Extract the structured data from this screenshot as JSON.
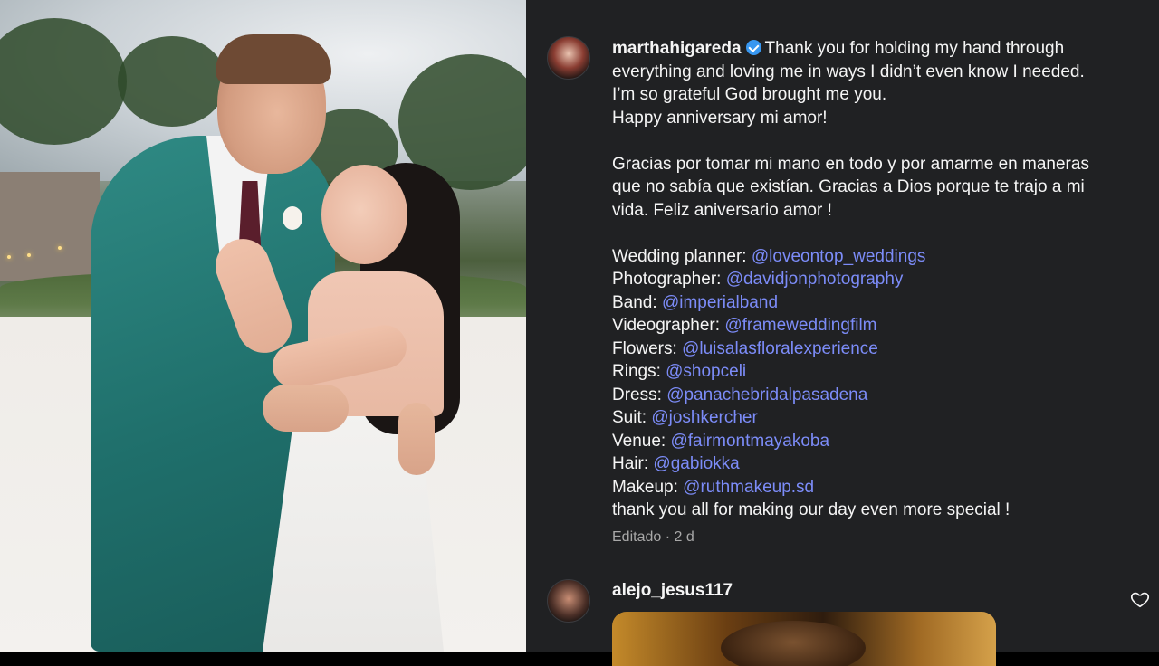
{
  "post": {
    "image_alt": "Wedding couple embracing on a beach",
    "author": {
      "username": "marthahigareda",
      "verified": true
    },
    "caption_lines": [
      "Thank you for holding my hand through",
      "everything and loving me in ways I didn’t even know I needed.",
      "I’m so grateful God brought me you.",
      "Happy anniversary mi amor!",
      "",
      "Gracias por tomar mi mano en todo y por amarme en maneras",
      "que no sabía que existían. Gracias a Dios porque te trajo a mi",
      "vida. Feliz aniversario amor !",
      ""
    ],
    "credits": [
      {
        "label": "Wedding planner: ",
        "mention": "@loveontop_weddings"
      },
      {
        "label": "Photographer: ",
        "mention": "@davidjonphotography"
      },
      {
        "label": "Band: ",
        "mention": "@imperialband"
      },
      {
        "label": "Videographer: ",
        "mention": "@frameweddingfilm"
      },
      {
        "label": "Flowers: ",
        "mention": "@luisalasfloralexperience"
      },
      {
        "label": "Rings: ",
        "mention": "@shopceli"
      },
      {
        "label": "Dress: ",
        "mention": "@panachebridalpasadena"
      },
      {
        "label": "Suit: ",
        "mention": "@joshkercher"
      },
      {
        "label": "Venue: ",
        "mention": "@fairmontmayakoba"
      },
      {
        "label": "Hair: ",
        "mention": "@gabiokka"
      },
      {
        "label": "Makeup: ",
        "mention": "@ruthmakeup.sd"
      }
    ],
    "closing": "thank you all for making our day even more special !",
    "meta": {
      "edited": "Editado",
      "separator": "·",
      "age": "2 d"
    }
  },
  "comments": [
    {
      "username": "alejo_jesus117",
      "icon": "heart-outline-icon"
    }
  ],
  "colors": {
    "panel_bg": "#202123",
    "mention": "#7c8cf8",
    "verified": "#3897f0",
    "meta": "#a8a8a8"
  }
}
